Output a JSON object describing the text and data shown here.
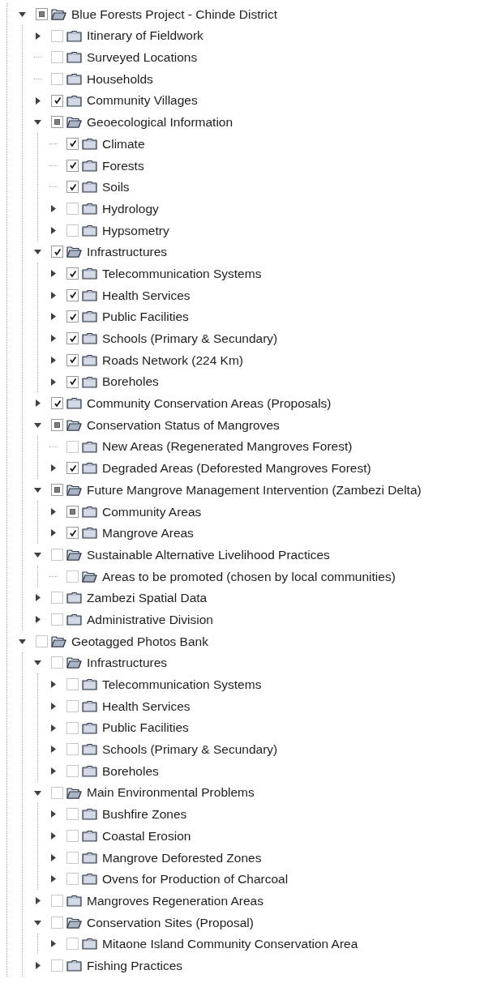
{
  "tree": [
    {
      "label": "Blue Forests Project - Chinde District",
      "checked": false,
      "partial": true,
      "expandable": true,
      "expanded": true,
      "children": [
        {
          "label": "Itinerary of Fieldwork",
          "checked": false,
          "partial": false,
          "expandable": true,
          "expanded": false
        },
        {
          "label": "Surveyed Locations",
          "checked": false,
          "partial": false,
          "expandable": false,
          "expanded": false
        },
        {
          "label": "Households",
          "checked": false,
          "partial": false,
          "expandable": false,
          "expanded": false
        },
        {
          "label": "Community Villages",
          "checked": true,
          "partial": false,
          "expandable": true,
          "expanded": false
        },
        {
          "label": "Geoecological Information",
          "checked": false,
          "partial": true,
          "expandable": true,
          "expanded": true,
          "children": [
            {
              "label": "Climate",
              "checked": true,
              "partial": false,
              "expandable": false,
              "expanded": false
            },
            {
              "label": "Forests",
              "checked": true,
              "partial": false,
              "expandable": false,
              "expanded": false
            },
            {
              "label": "Soils",
              "checked": true,
              "partial": false,
              "expandable": false,
              "expanded": false
            },
            {
              "label": "Hydrology",
              "checked": false,
              "partial": false,
              "expandable": true,
              "expanded": false
            },
            {
              "label": "Hypsometry",
              "checked": false,
              "partial": false,
              "expandable": true,
              "expanded": false
            }
          ]
        },
        {
          "label": "Infrastructures",
          "checked": true,
          "partial": false,
          "expandable": true,
          "expanded": true,
          "children": [
            {
              "label": "Telecommunication Systems",
              "checked": true,
              "partial": false,
              "expandable": true,
              "expanded": false
            },
            {
              "label": "Health Services",
              "checked": true,
              "partial": false,
              "expandable": true,
              "expanded": false
            },
            {
              "label": "Public Facilities",
              "checked": true,
              "partial": false,
              "expandable": true,
              "expanded": false
            },
            {
              "label": "Schools (Primary & Secundary)",
              "checked": true,
              "partial": false,
              "expandable": true,
              "expanded": false
            },
            {
              "label": "Roads Network (224 Km)",
              "checked": true,
              "partial": false,
              "expandable": true,
              "expanded": false
            },
            {
              "label": "Boreholes",
              "checked": true,
              "partial": false,
              "expandable": true,
              "expanded": false
            }
          ]
        },
        {
          "label": "Community Conservation Areas (Proposals)",
          "checked": true,
          "partial": false,
          "expandable": true,
          "expanded": false
        },
        {
          "label": "Conservation Status of Mangroves",
          "checked": false,
          "partial": true,
          "expandable": true,
          "expanded": true,
          "children": [
            {
              "label": "New Areas (Regenerated Mangroves Forest)",
              "checked": false,
              "partial": false,
              "expandable": false,
              "expanded": false
            },
            {
              "label": "Degraded Areas (Deforested Mangroves Forest)",
              "checked": true,
              "partial": false,
              "expandable": true,
              "expanded": false
            }
          ]
        },
        {
          "label": "Future Mangrove Management Intervention (Zambezi Delta)",
          "checked": false,
          "partial": true,
          "expandable": true,
          "expanded": true,
          "children": [
            {
              "label": "Community Areas",
              "checked": false,
              "partial": true,
              "expandable": true,
              "expanded": false
            },
            {
              "label": "Mangrove Areas",
              "checked": true,
              "partial": false,
              "expandable": true,
              "expanded": false
            }
          ]
        },
        {
          "label": "Sustainable Alternative Livelihood Practices",
          "checked": false,
          "partial": false,
          "expandable": true,
          "expanded": true,
          "children": [
            {
              "label": "Areas to be promoted (chosen by local communities)",
              "checked": false,
              "partial": false,
              "expandable": false,
              "expanded": true
            }
          ]
        },
        {
          "label": "Zambezi Spatial Data",
          "checked": false,
          "partial": false,
          "expandable": true,
          "expanded": false
        },
        {
          "label": "Administrative Division",
          "checked": false,
          "partial": false,
          "expandable": true,
          "expanded": false
        }
      ]
    },
    {
      "label": "Geotagged Photos Bank",
      "checked": false,
      "partial": false,
      "expandable": true,
      "expanded": true,
      "children": [
        {
          "label": "Infrastructures",
          "checked": false,
          "partial": false,
          "expandable": true,
          "expanded": true,
          "children": [
            {
              "label": "Telecommunication Systems",
              "checked": false,
              "partial": false,
              "expandable": true,
              "expanded": false
            },
            {
              "label": "Health Services",
              "checked": false,
              "partial": false,
              "expandable": true,
              "expanded": false
            },
            {
              "label": "Public Facilities",
              "checked": false,
              "partial": false,
              "expandable": true,
              "expanded": false
            },
            {
              "label": "Schools (Primary & Secundary)",
              "checked": false,
              "partial": false,
              "expandable": true,
              "expanded": false
            },
            {
              "label": "Boreholes",
              "checked": false,
              "partial": false,
              "expandable": true,
              "expanded": false
            }
          ]
        },
        {
          "label": "Main Environmental Problems",
          "checked": false,
          "partial": false,
          "expandable": true,
          "expanded": true,
          "children": [
            {
              "label": "Bushfire Zones",
              "checked": false,
              "partial": false,
              "expandable": true,
              "expanded": false
            },
            {
              "label": "Coastal Erosion",
              "checked": false,
              "partial": false,
              "expandable": true,
              "expanded": false
            },
            {
              "label": "Mangrove Deforested Zones",
              "checked": false,
              "partial": false,
              "expandable": true,
              "expanded": false
            },
            {
              "label": "Ovens for Production of Charcoal",
              "checked": false,
              "partial": false,
              "expandable": true,
              "expanded": false
            }
          ]
        },
        {
          "label": "Mangroves Regeneration Areas",
          "checked": false,
          "partial": false,
          "expandable": true,
          "expanded": false
        },
        {
          "label": "Conservation Sites (Proposal)",
          "checked": false,
          "partial": false,
          "expandable": true,
          "expanded": true,
          "children": [
            {
              "label": "Mitaone Island Community Conservation Area",
              "checked": false,
              "partial": false,
              "expandable": true,
              "expanded": false
            }
          ]
        },
        {
          "label": "Fishing Practices",
          "checked": false,
          "partial": false,
          "expandable": true,
          "expanded": false
        }
      ]
    }
  ]
}
